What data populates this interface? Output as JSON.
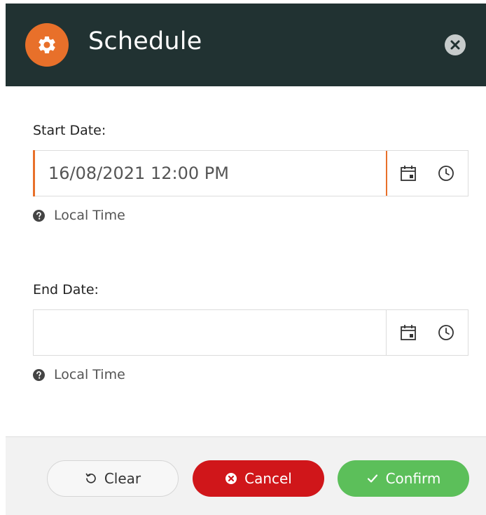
{
  "dialog": {
    "title": "Schedule",
    "header_color": "#213232",
    "accent_color": "#e8702a"
  },
  "header": {
    "badge_icon": "gear-icon",
    "close_icon": "close-icon"
  },
  "start_date": {
    "label": "Start Date:",
    "value": "16/08/2021 12:00 PM",
    "placeholder": "",
    "calendar_icon": "calendar-icon",
    "clock_icon": "clock-icon",
    "help_icon": "question-circle-icon",
    "help_text": "Local Time",
    "focused": true
  },
  "end_date": {
    "label": "End Date:",
    "value": "",
    "placeholder": "",
    "calendar_icon": "calendar-icon",
    "clock_icon": "clock-icon",
    "help_icon": "question-circle-icon",
    "help_text": "Local Time",
    "focused": false
  },
  "footer": {
    "clear_label": "Clear",
    "clear_icon": "undo-icon",
    "cancel_label": "Cancel",
    "cancel_icon": "close-circle-icon",
    "cancel_color": "#d0161a",
    "confirm_label": "Confirm",
    "confirm_icon": "check-icon",
    "confirm_color": "#5cbf5a"
  }
}
